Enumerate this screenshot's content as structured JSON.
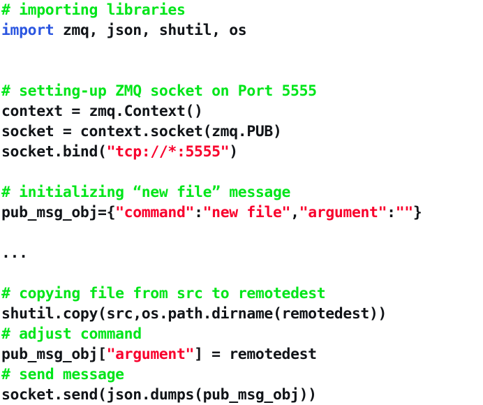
{
  "document": {
    "type": "source-code-listing",
    "language": "python",
    "background_color": "#ffffff",
    "colors": {
      "comment": "#00e519",
      "keyword": "#2b56e0",
      "string": "#f8002c",
      "plain": "#111418"
    }
  },
  "code": {
    "lines": [
      {
        "id": "line-1",
        "text": "# importing libraries",
        "tokens": [
          {
            "t": "# importing libraries",
            "k": "comment"
          }
        ]
      },
      {
        "id": "line-2",
        "text": "import zmq, json, shutil, os",
        "tokens": [
          {
            "t": "import",
            "k": "keyword"
          },
          {
            "t": " zmq, json, shutil, os",
            "k": "plain"
          }
        ]
      },
      {
        "id": "line-3",
        "text": "",
        "tokens": []
      },
      {
        "id": "line-4",
        "text": "",
        "tokens": []
      },
      {
        "id": "line-5",
        "text": "# setting-up ZMQ socket on Port 5555",
        "tokens": [
          {
            "t": "# setting-up ZMQ socket on Port 5555",
            "k": "comment"
          }
        ]
      },
      {
        "id": "line-6",
        "text": "context = zmq.Context()",
        "tokens": [
          {
            "t": "context = zmq.Context()",
            "k": "plain"
          }
        ]
      },
      {
        "id": "line-7",
        "text": "socket = context.socket(zmq.PUB)",
        "tokens": [
          {
            "t": "socket = context.socket(zmq.PUB)",
            "k": "plain"
          }
        ]
      },
      {
        "id": "line-8",
        "text": "socket.bind(\"tcp://*:5555\")",
        "tokens": [
          {
            "t": "socket.bind(",
            "k": "plain"
          },
          {
            "t": "\"tcp://*:5555\"",
            "k": "string"
          },
          {
            "t": ")",
            "k": "plain"
          }
        ]
      },
      {
        "id": "line-9",
        "text": "",
        "tokens": []
      },
      {
        "id": "line-10",
        "text": "# initializing “new file” message",
        "tokens": [
          {
            "t": "# initializing “new file” message",
            "k": "comment"
          }
        ]
      },
      {
        "id": "line-11",
        "text": "pub_msg_obj={\"command\":\"new file\",\"argument\":\"\"}",
        "tokens": [
          {
            "t": "pub_msg_obj={",
            "k": "plain"
          },
          {
            "t": "\"command\"",
            "k": "string"
          },
          {
            "t": ":",
            "k": "plain"
          },
          {
            "t": "\"new file\"",
            "k": "string"
          },
          {
            "t": ",",
            "k": "plain"
          },
          {
            "t": "\"argument\"",
            "k": "string"
          },
          {
            "t": ":",
            "k": "plain"
          },
          {
            "t": "\"\"",
            "k": "string"
          },
          {
            "t": "}",
            "k": "plain"
          }
        ]
      },
      {
        "id": "line-12",
        "text": "",
        "tokens": []
      },
      {
        "id": "line-13",
        "text": "...",
        "tokens": [
          {
            "t": "...",
            "k": "plain"
          }
        ]
      },
      {
        "id": "line-14",
        "text": "",
        "tokens": []
      },
      {
        "id": "line-15",
        "text": "# copying file from src to remotedest",
        "tokens": [
          {
            "t": "# copying file from ",
            "k": "comment"
          },
          {
            "t": "src",
            "k": "comment-strong"
          },
          {
            "t": " to ",
            "k": "comment"
          },
          {
            "t": "remotedest",
            "k": "comment-strong"
          }
        ]
      },
      {
        "id": "line-16",
        "text": "shutil.copy(src,os.path.dirname(remotedest))",
        "tokens": [
          {
            "t": "shutil.copy(src,os.path.dirname(remotedest))",
            "k": "plain"
          }
        ]
      },
      {
        "id": "line-17",
        "text": "# adjust command",
        "tokens": [
          {
            "t": "# adjust command",
            "k": "comment"
          }
        ]
      },
      {
        "id": "line-18",
        "text": "pub_msg_obj[\"argument\"] = remotedest",
        "tokens": [
          {
            "t": "pub_msg_obj[",
            "k": "plain"
          },
          {
            "t": "\"argument\"",
            "k": "string"
          },
          {
            "t": "] = remotedest",
            "k": "plain"
          }
        ]
      },
      {
        "id": "line-19",
        "text": "# send message",
        "tokens": [
          {
            "t": "# send message",
            "k": "comment"
          }
        ]
      },
      {
        "id": "line-20",
        "text": "socket.send(json.dumps(pub_msg_obj))",
        "tokens": [
          {
            "t": "socket.send(json.dumps(pub_msg_obj))",
            "k": "plain"
          }
        ]
      }
    ]
  }
}
